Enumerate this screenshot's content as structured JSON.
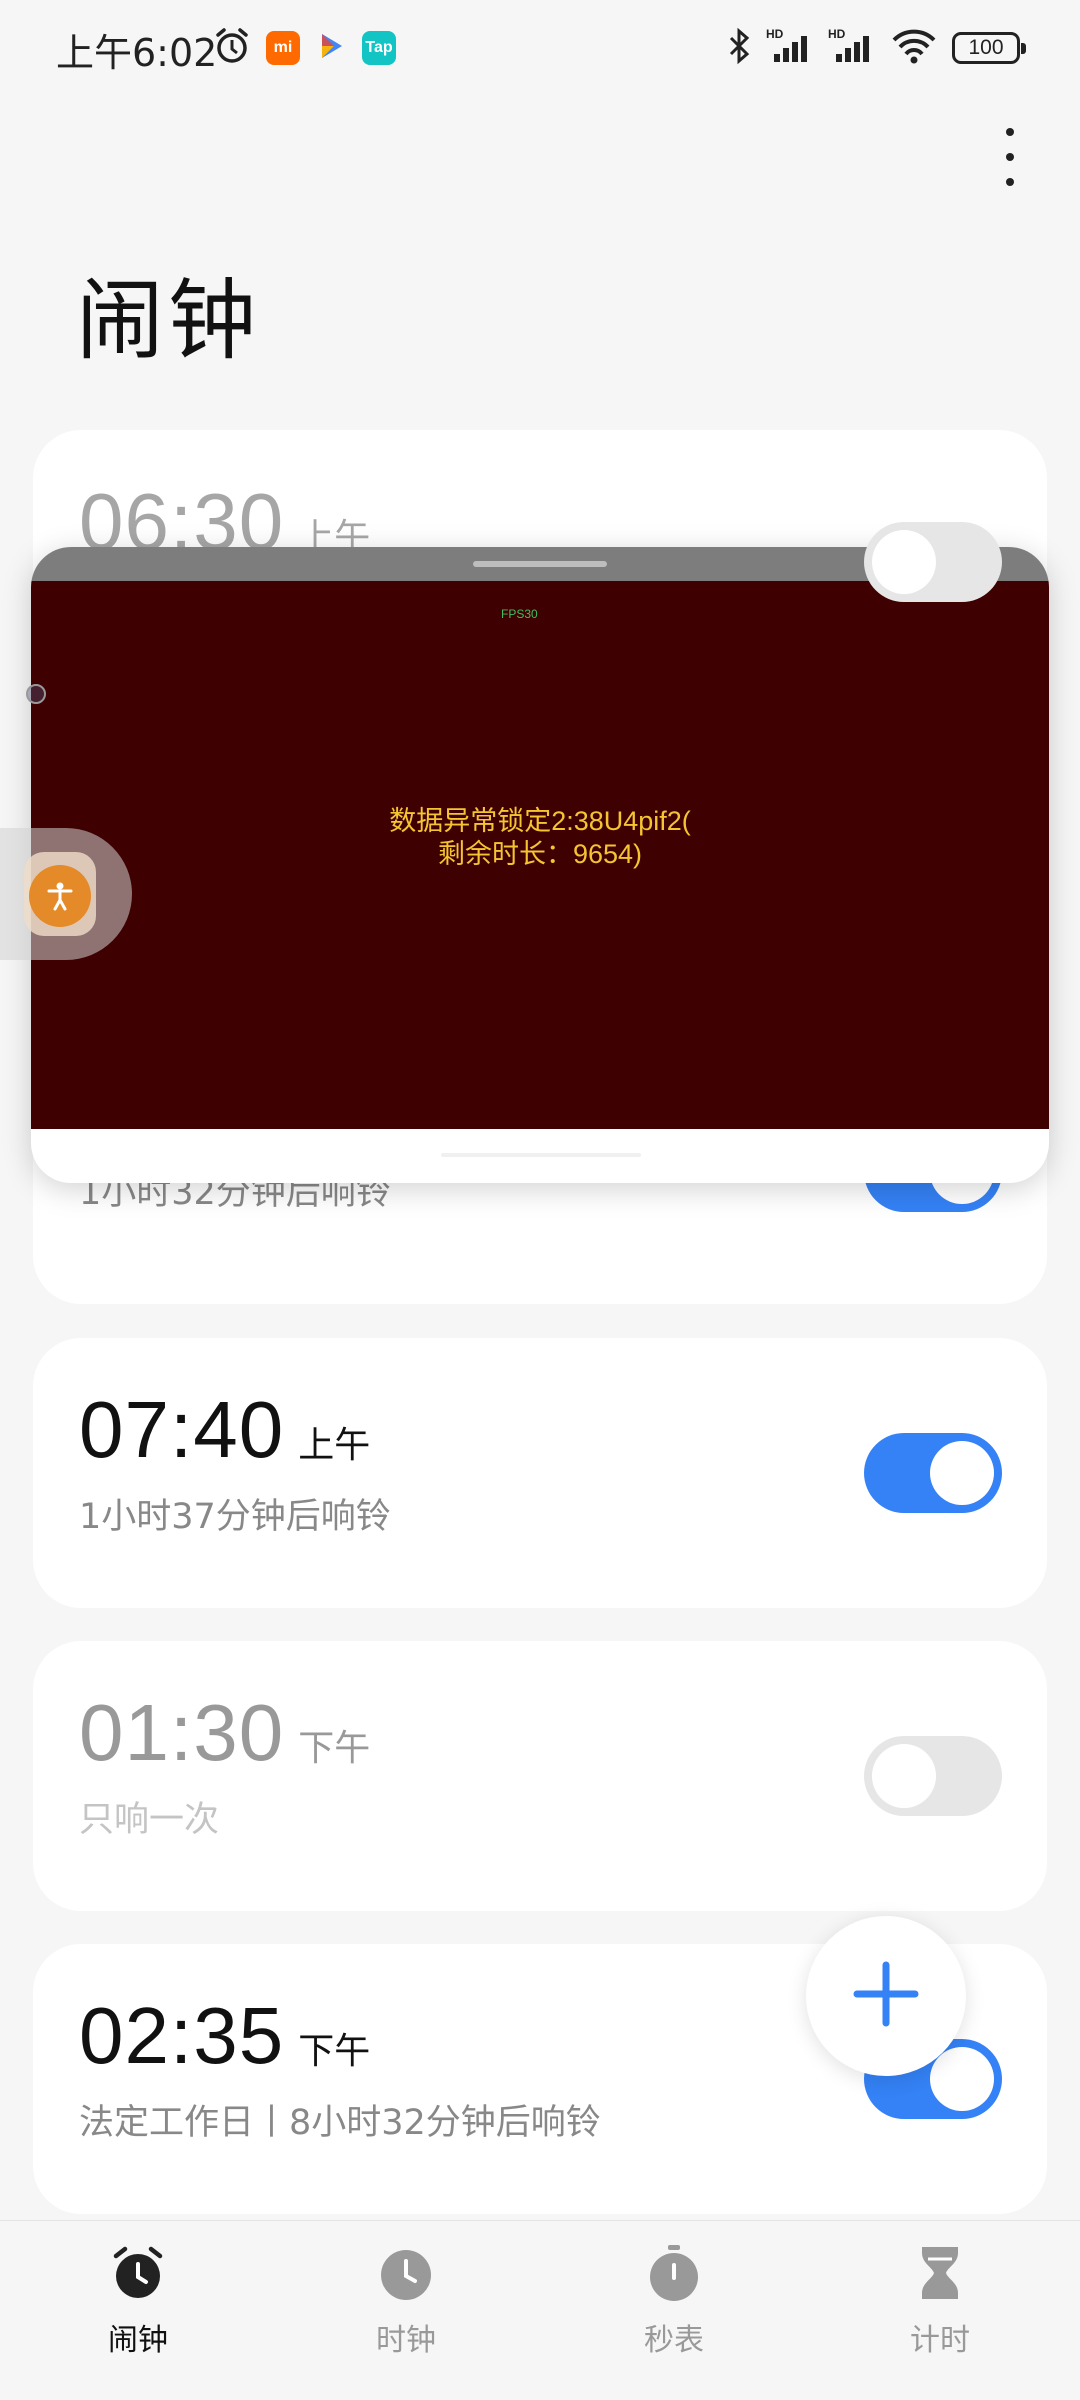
{
  "status_bar": {
    "time": "上午6:02",
    "battery": "100",
    "app_badges": [
      {
        "label": "mi",
        "color": "#ff6a00"
      },
      {
        "label": "Tap",
        "color": "#13c4c4"
      }
    ]
  },
  "page": {
    "title": "闹钟"
  },
  "alarms": [
    {
      "time": "06:30",
      "period": "上午",
      "subtitle": "1小时32分钟后响铃",
      "enabled": true
    },
    {
      "time": "07:40",
      "period": "上午",
      "subtitle": "1小时37分钟后响铃",
      "enabled": true
    },
    {
      "time": "01:30",
      "period": "下午",
      "subtitle": "只响一次",
      "enabled": false
    },
    {
      "time": "02:35",
      "period": "下午",
      "subtitle": "法定工作日丨8小时32分钟后响铃",
      "enabled": true
    }
  ],
  "overlay": {
    "fps": "FPS30",
    "message_line1": "数据异常锁定2:38U4pif2(",
    "message_line2": "剩余时长：9654)"
  },
  "nav": {
    "items": [
      {
        "label": "闹钟",
        "icon": "alarm-clock-icon",
        "active": true
      },
      {
        "label": "时钟",
        "icon": "clock-icon",
        "active": false
      },
      {
        "label": "秒表",
        "icon": "stopwatch-icon",
        "active": false
      },
      {
        "label": "计时",
        "icon": "hourglass-icon",
        "active": false
      }
    ]
  },
  "colors": {
    "accent": "#3482f6",
    "overlay_background": "#3e0000",
    "overlay_text": "#f5c431"
  }
}
